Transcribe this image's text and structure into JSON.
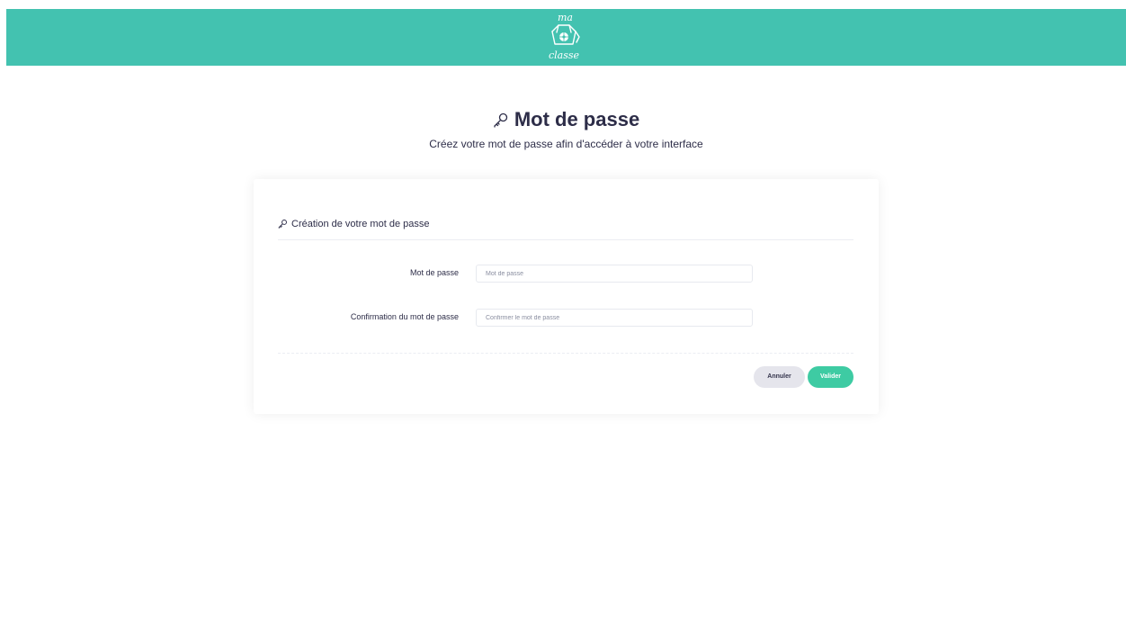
{
  "header": {
    "logo": {
      "line1": "ma",
      "line2": "classe",
      "icon": "open-box-with-flower-icon"
    },
    "background_color": "#43c2b0"
  },
  "page": {
    "title": "Mot de passe",
    "title_icon": "key-icon",
    "subtitle": "Créez votre mot de passe afin d'accéder à votre interface"
  },
  "form": {
    "section_title": "Création de votre mot de passe",
    "section_icon": "key-icon",
    "fields": [
      {
        "label": "Mot de passe",
        "value": "",
        "placeholder": "Mot de passe"
      },
      {
        "label": "Confirmation du mot de passe",
        "value": "",
        "placeholder": "Confirmer le mot de passe"
      }
    ],
    "cancel_label": "Annuler",
    "submit_label": "Valider"
  },
  "colors": {
    "accent": "#43c2b0",
    "submit": "#3ecba3",
    "cancel": "#e5e5ec",
    "text": "#2d2d48"
  }
}
